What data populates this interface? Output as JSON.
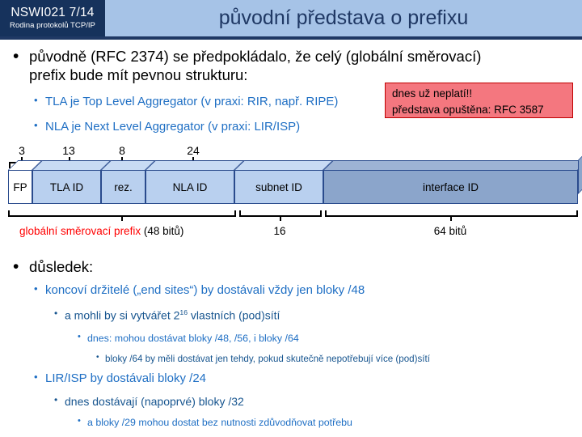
{
  "header": {
    "course_code": "NSWI021   7/14",
    "course_name": "Rodina protokolů TCP/IP",
    "title": "původní představa o prefixu"
  },
  "note": {
    "line1": "dnes už neplatí!!",
    "line2": "představa opuštěna: RFC 3587"
  },
  "bullets": {
    "main1_line1": "původně (RFC 2374) se předpokládalo, že celý (globální směrovací)",
    "main1_line2": "prefix bude mít pevnou strukturu:",
    "sub1": "TLA je Top Level Aggregator (v praxi: RIR, např. RIPE)",
    "sub2": "NLA je Next Level Aggregator (v praxi: LIR/ISP)",
    "main2": "důsledek:",
    "d1": "koncoví držitelé („end sites“) by dostávali vždy jen bloky /48",
    "d1a_pre": "a mohli by si vytvářet 2",
    "d1a_sup": "16",
    "d1a_post": " vlastních (pod)sítí",
    "d1b": "dnes: mohou dostávat bloky /48, /56, i bloky /64",
    "d1c": "bloky /64 by měli dostávat jen tehdy, pokud skutečně nepotřebují více (pod)sítí",
    "d2": "LIR/ISP by dostávali bloky /24",
    "d2a": "dnes dostávají (napoprvé) bloky /32",
    "d2b": "a bloky /29 mohou dostat bez nutnosti zdůvodňovat potřebu"
  },
  "diagram": {
    "segments": [
      {
        "label": "FP",
        "bits": "3",
        "shade": "white"
      },
      {
        "label": "TLA ID",
        "bits": "13",
        "shade": "light"
      },
      {
        "label": "rez.",
        "bits": "8",
        "shade": "light"
      },
      {
        "label": "NLA ID",
        "bits": "24",
        "shade": "light"
      },
      {
        "label": "subnet  ID",
        "bits": "",
        "shade": "light"
      },
      {
        "label": "interface ID",
        "bits": "",
        "shade": "dark"
      }
    ],
    "top_bits": [
      "3",
      "13",
      "8",
      "24"
    ],
    "bottom_prefix_red": "globální směrovací prefix",
    "bottom_prefix_black": " (48 bitů)",
    "bottom_subnet": "16",
    "bottom_interface": "64 bitů"
  },
  "colors": {
    "header_band": "#a6c3e7",
    "logo_navy": "#16325c",
    "title_navy": "#1f3864",
    "accent_blue": "#1f6fc4",
    "note_bg": "#f4777f",
    "note_border": "#c00000",
    "red_text": "#ff0000",
    "seg_light": "#b9d0ef",
    "seg_dark": "#8ba5cb"
  }
}
